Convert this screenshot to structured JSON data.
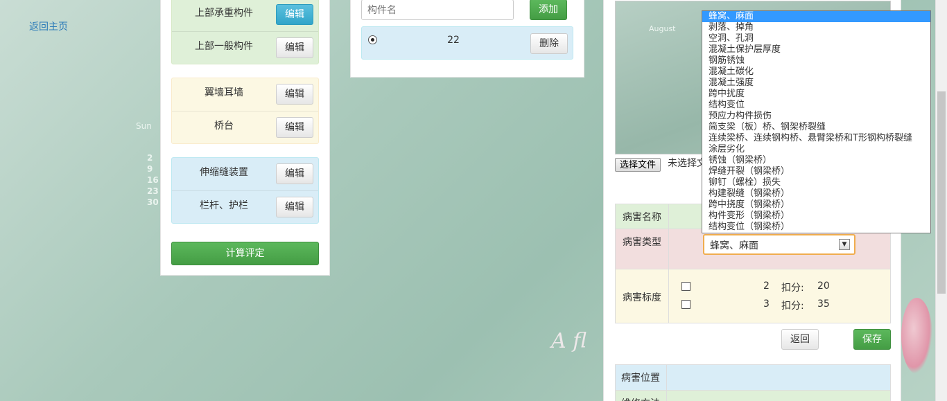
{
  "nav": {
    "home_link": "返回主页"
  },
  "background": {
    "calendar_day": "Sun",
    "calendar_numbers": [
      "2",
      "9",
      "16",
      "23",
      "30"
    ],
    "calendar_month": "August",
    "deco_text": "A fl"
  },
  "left_panel": {
    "groups": [
      {
        "items": [
          {
            "label": "上部承重构件",
            "button": "编辑",
            "active": true
          },
          {
            "label": "上部一般构件",
            "button": "编辑"
          }
        ]
      },
      {
        "items": [
          {
            "label": "翼墙耳墙",
            "button": "编辑"
          },
          {
            "label": "桥台",
            "button": "编辑"
          }
        ]
      },
      {
        "items": [
          {
            "label": "伸缩缝装置",
            "button": "编辑"
          },
          {
            "label": "栏杆、护栏",
            "button": "编辑"
          }
        ]
      }
    ],
    "calc_button": "计算评定"
  },
  "middle_panel": {
    "component_input_placeholder": "构件名",
    "add_button": "添加",
    "row": {
      "value": "22",
      "delete_button": "删除"
    }
  },
  "right_panel": {
    "file_button": "选择文件",
    "file_status": "未选择文",
    "table": {
      "name_label": "病害名称",
      "type_label": "病害类型",
      "type_selected": "蜂窝、麻面",
      "level_label": "病害标度",
      "levels": [
        {
          "value": "2",
          "deduct_label": "扣分:",
          "deduct": "20"
        },
        {
          "value": "3",
          "deduct_label": "扣分:",
          "deduct": "35"
        }
      ]
    },
    "back_button": "返回",
    "save_button": "保存",
    "table2": {
      "position_label": "病害位置",
      "repair_label": "维修方法"
    }
  },
  "dropdown": {
    "options": [
      "蜂窝、麻面",
      "剥落、掉角",
      "空洞、孔洞",
      "混凝土保护层厚度",
      "钢筋锈蚀",
      "混凝土碳化",
      "混凝土强度",
      "跨中扰度",
      "结构变位",
      "预应力构件损伤",
      "简支梁（板）桥、钢架桥裂缝",
      "连续梁桥、连续钢构桥、悬臂梁桥和T形钢构桥裂缝",
      "涂层劣化",
      "锈蚀（钢梁桥）",
      "焊缝开裂（钢梁桥）",
      "铆钉（螺栓）损失",
      "构建裂缝（钢梁桥）",
      "跨中挠度（钢梁桥）",
      "构件变形（钢梁桥）",
      "结构变位（钢梁桥）"
    ],
    "selected_index": 0
  }
}
